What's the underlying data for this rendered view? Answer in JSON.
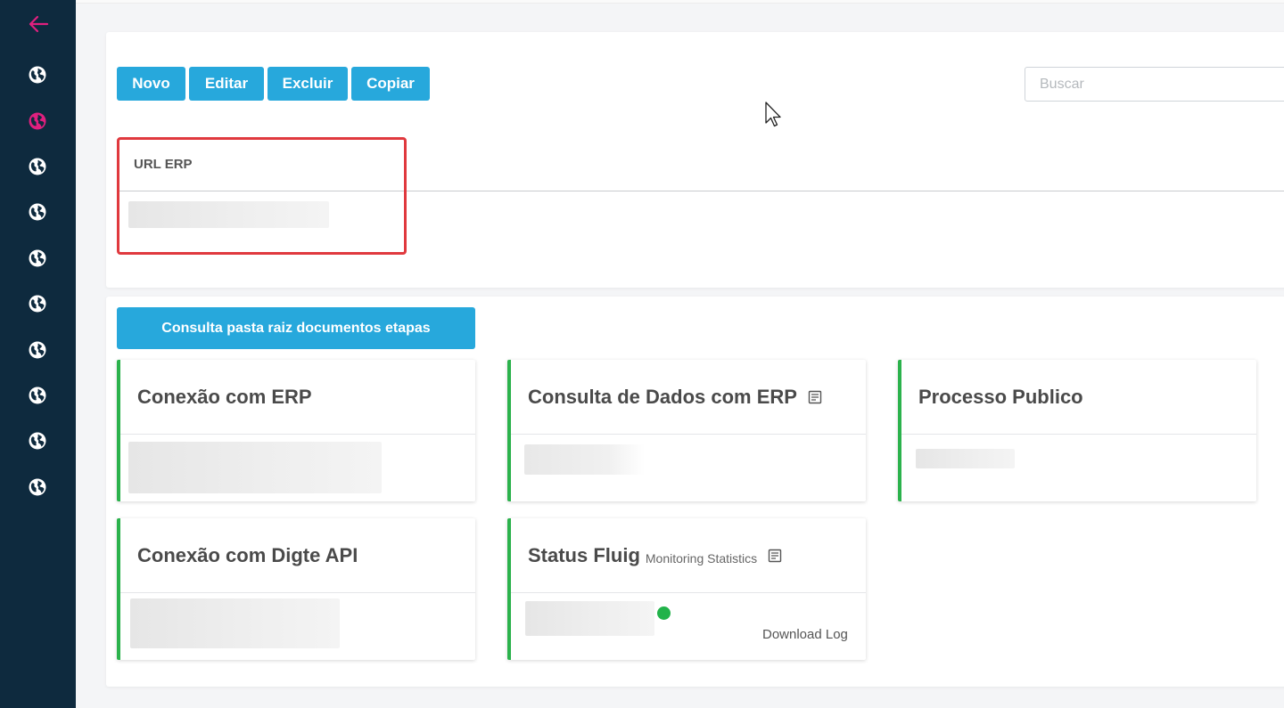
{
  "sidebar": {
    "back_icon": "arrow-left-icon",
    "items": [
      {
        "icon": "globe-icon",
        "active": false
      },
      {
        "icon": "globe-icon",
        "active": true
      },
      {
        "icon": "globe-icon",
        "active": false
      },
      {
        "icon": "globe-icon",
        "active": false
      },
      {
        "icon": "globe-icon",
        "active": false
      },
      {
        "icon": "globe-icon",
        "active": false
      },
      {
        "icon": "globe-icon",
        "active": false
      },
      {
        "icon": "globe-icon",
        "active": false
      },
      {
        "icon": "globe-icon",
        "active": false
      },
      {
        "icon": "globe-icon",
        "active": false
      }
    ],
    "colors": {
      "background": "#0e2a3e",
      "active": "#e0207f",
      "icon": "#ffffff"
    }
  },
  "toolbar": {
    "novo_label": "Novo",
    "editar_label": "Editar",
    "excluir_label": "Excluir",
    "copiar_label": "Copiar",
    "button_color": "#27a8dc"
  },
  "search": {
    "placeholder": "Buscar",
    "value": ""
  },
  "table": {
    "columns": [
      "URL ERP"
    ],
    "rows": [
      [
        "(blurred)"
      ]
    ]
  },
  "consulta_button_label": "Consulta pasta raiz documentos etapas",
  "cards": [
    {
      "title": "Conexão com ERP",
      "subtitle": "",
      "has_doc_icon": false
    },
    {
      "title": "Consulta de Dados com ERP",
      "subtitle": "",
      "has_doc_icon": true
    },
    {
      "title": "Processo Publico",
      "subtitle": "",
      "has_doc_icon": false
    },
    {
      "title": "Conexão com Digte API",
      "subtitle": "",
      "has_doc_icon": false
    },
    {
      "title": "Status Fluig",
      "subtitle": "Monitoring Statistics",
      "has_doc_icon": true,
      "status": "online",
      "status_color": "#22b34a",
      "link": "Download Log"
    }
  ],
  "accent_border_color": "#2bb24c",
  "highlight_color": "#e0393e"
}
